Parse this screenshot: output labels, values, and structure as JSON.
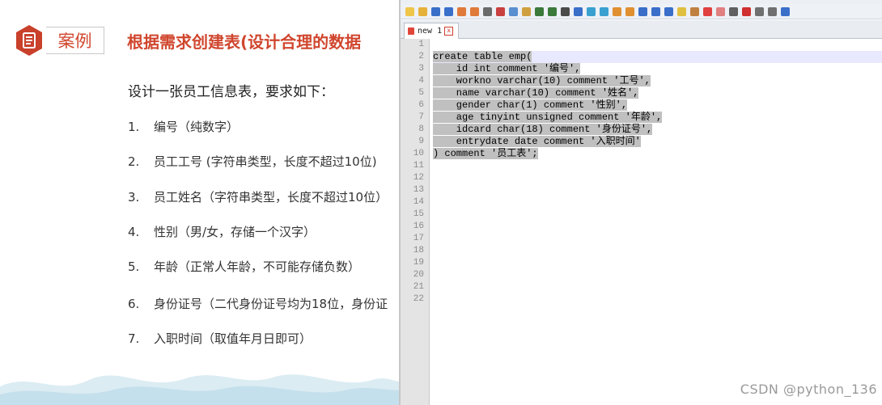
{
  "slide": {
    "badge_label": "案例",
    "title": "根据需求创建表(设计合理的数据",
    "subtitle": "设计一张员工信息表，要求如下：",
    "requirements": [
      {
        "num": "1.",
        "text": "编号（纯数字）"
      },
      {
        "num": "2.",
        "text": "员工工号 (字符串类型，长度不超过10位)"
      },
      {
        "num": "3.",
        "text": "员工姓名（字符串类型，长度不超过10位）"
      },
      {
        "num": "4.",
        "text": "性别（男/女，存储一个汉字）"
      },
      {
        "num": "5.",
        "text": "年龄（正常人年龄，不可能存储负数）"
      },
      {
        "num": "6.",
        "text": "身份证号（二代身份证号均为18位，身份证"
      },
      {
        "num": "7.",
        "text": "入职时间（取值年月日即可）"
      }
    ],
    "colors": {
      "accent": "#d0462e",
      "wave": "#cfe6f0"
    }
  },
  "editor": {
    "tab_label": "new 1",
    "close_symbol": "x",
    "line_numbers": [
      "1",
      "2",
      "3",
      "4",
      "5",
      "6",
      "7",
      "8",
      "9",
      "10",
      "11",
      "12",
      "13",
      "14",
      "15",
      "16",
      "17",
      "18",
      "19",
      "20",
      "21",
      "22"
    ],
    "code_lines": [
      "",
      "create table emp(",
      "    id int comment '编号',",
      "    workno varchar(10) comment '工号',",
      "    name varchar(10) comment '姓名',",
      "    gender char(1) comment '性别',",
      "    age tinyint unsigned comment '年龄',",
      "    idcard char(18) comment '身份证号',",
      "    entrydate date comment '入职时间'",
      ") comment '员工表';"
    ],
    "toolbar_icons": [
      "new-file-icon",
      "open-icon",
      "save-icon",
      "save-all-icon",
      "close-icon",
      "close-all-icon",
      "print-icon",
      "cut-icon",
      "copy-icon",
      "paste-icon",
      "undo-icon",
      "redo-icon",
      "find-icon",
      "replace-icon",
      "zoom-in-icon",
      "zoom-out-icon",
      "sync-v-icon",
      "sync-h-icon",
      "wrap-icon",
      "all-chars-icon",
      "indent-guide-icon",
      "doc-map-icon",
      "function-list-icon",
      "folder-icon",
      "monitor-icon",
      "record-icon",
      "stop-icon",
      "play-icon",
      "play-multi-icon",
      "save-macro-icon"
    ]
  },
  "watermark": "CSDN @python_136"
}
